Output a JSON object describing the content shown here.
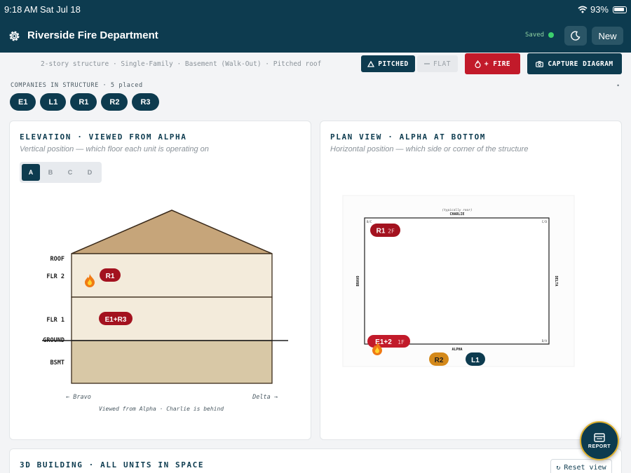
{
  "status_bar": {
    "time": "9:18 AM",
    "date": "Sat Jul 18",
    "battery": "93%"
  },
  "header": {
    "title": "Riverside Fire Department",
    "saved_label": "Saved",
    "new_label": "New"
  },
  "toolbar": {
    "structure_desc": "2-story structure · Single-Family · Basement (Walk-Out) · Pitched roof",
    "pitched_label": "PITCHED",
    "flat_label": "FLAT",
    "fire_label": "+ FIRE",
    "capture_label": "CAPTURE DIAGRAM"
  },
  "companies": {
    "label": "COMPANIES IN STRUCTURE · 5 placed",
    "more": "•",
    "chips": [
      "E1",
      "L1",
      "R1",
      "R2",
      "R3"
    ]
  },
  "elevation": {
    "title": "ELEVATION · VIEWED FROM ALPHA",
    "subtitle": "Vertical position — which floor each unit is operating on",
    "views": [
      "A",
      "B",
      "C",
      "D"
    ],
    "active_view": "A",
    "floors": [
      "ROOF",
      "FLR 2",
      "FLR 1",
      "GROUND",
      "BSMT"
    ],
    "units": {
      "flr2": "R1",
      "flr1": "E1+R3"
    },
    "left_side": "← Bravo",
    "right_side": "Delta →",
    "caption": "Viewed from Alpha · Charlie is behind"
  },
  "plan": {
    "title": "PLAN VIEW · ALPHA AT BOTTOM",
    "subtitle": "Horizontal position — which side or corner of the structure",
    "top_side": "CHARLIE",
    "top_note": "(typically rear)",
    "bottom_side": "ALPHA",
    "left_side": "BRAVO",
    "right_side": "DELTA",
    "corner_bc": "B/C",
    "corner_cd": "C/D",
    "corner_da": "D/A",
    "units": [
      {
        "label": "R1",
        "floor": "2F",
        "color": "#a3121f"
      },
      {
        "label": "E1+2",
        "floor": "1F",
        "color": "#c21a2a"
      },
      {
        "label": "R2",
        "floor": "",
        "color": "#d4891a"
      },
      {
        "label": "L1",
        "floor": "",
        "color": "#0d3b4f"
      }
    ]
  },
  "building_3d": {
    "title": "3D BUILDING · ALL UNITS IN SPACE",
    "reset_label": "Reset view"
  },
  "report": {
    "label": "REPORT"
  },
  "colors": {
    "navy": "#0d3b4f",
    "fire_red": "#c21a2a",
    "unit_red": "#a3121f",
    "amber": "#d4891a",
    "saved_green": "#3ccf6d"
  }
}
